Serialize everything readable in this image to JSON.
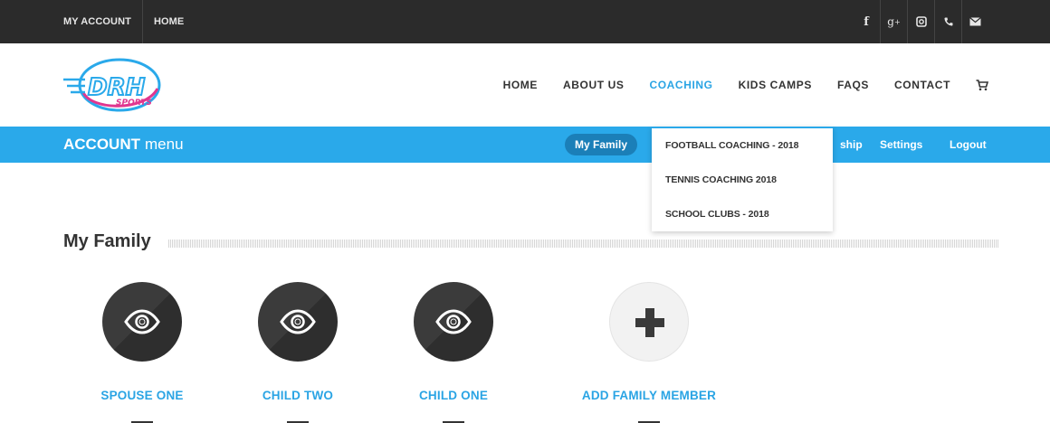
{
  "topbar": {
    "links": [
      "MY ACCOUNT",
      "HOME"
    ],
    "social_icons": [
      "facebook-icon",
      "google-plus-icon",
      "instagram-icon",
      "phone-icon",
      "mail-icon"
    ]
  },
  "header": {
    "logo_text": "DRH",
    "logo_sub": "SPORTS",
    "nav": [
      "HOME",
      "ABOUT US",
      "COACHING",
      "KIDS CAMPS",
      "FAQS",
      "CONTACT"
    ],
    "active_nav": "COACHING",
    "cart_icon": "cart-icon"
  },
  "account_bar": {
    "title_bold": "ACCOUNT",
    "title_light": "menu",
    "items": [
      "My Family",
      "ship",
      "Settings",
      "Logout"
    ],
    "active_item": "My Family"
  },
  "dropdown": {
    "items": [
      "FOOTBALL COACHING - 2018",
      "TENNIS COACHING 2018",
      "SCHOOL CLUBS - 2018"
    ]
  },
  "section": {
    "title": "My Family"
  },
  "members": [
    {
      "name": "SPOUSE ONE",
      "icon": "eye-icon"
    },
    {
      "name": "CHILD TWO",
      "icon": "eye-icon"
    },
    {
      "name": "CHILD ONE",
      "icon": "eye-icon"
    },
    {
      "name": "ADD FAMILY MEMBER",
      "icon": "plus-icon"
    }
  ],
  "colors": {
    "topbar_bg": "#2b2b2b",
    "accent": "#2aa9ea",
    "pill": "#1b7fb8",
    "logo_pink": "#e0368f"
  }
}
